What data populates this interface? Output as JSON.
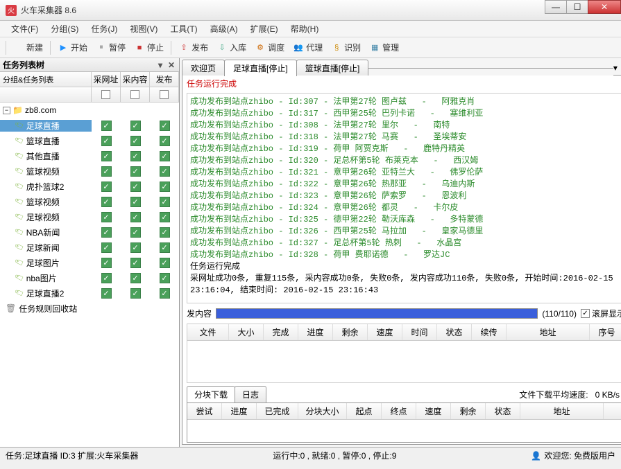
{
  "window": {
    "title": "火车采集器 8.6"
  },
  "menu": [
    "文件(F)",
    "分组(S)",
    "任务(J)",
    "视图(V)",
    "工具(T)",
    "高级(A)",
    "扩展(E)",
    "帮助(H)"
  ],
  "toolbar": [
    {
      "label": "新建",
      "icon": "",
      "color": "#555"
    },
    {
      "label": "开始",
      "icon": "▶",
      "color": "#1e90ff"
    },
    {
      "label": "暂停",
      "icon": "⏸",
      "color": "#888"
    },
    {
      "label": "停止",
      "icon": "■",
      "color": "#c33"
    },
    {
      "label": "发布",
      "icon": "⇧",
      "color": "#c33"
    },
    {
      "label": "入库",
      "icon": "⇩",
      "color": "#4a8"
    },
    {
      "label": "调度",
      "icon": "⚙",
      "color": "#c60"
    },
    {
      "label": "代理",
      "icon": "👥",
      "color": "#c33"
    },
    {
      "label": "识别",
      "icon": "§",
      "color": "#c80"
    },
    {
      "label": "管理",
      "icon": "▦",
      "color": "#48a"
    }
  ],
  "leftPane": {
    "title": "任务列表树",
    "headers": {
      "name": "分组&任务列表",
      "c1": "采网址",
      "c2": "采内容",
      "c3": "发布"
    },
    "root": "zb8.com",
    "tasks": [
      {
        "name": "足球直播",
        "selected": true
      },
      {
        "name": "篮球直播"
      },
      {
        "name": "其他直播"
      },
      {
        "name": "篮球视频"
      },
      {
        "name": "虎扑篮球2"
      },
      {
        "name": "篮球视频"
      },
      {
        "name": "足球视频"
      },
      {
        "name": "NBA新闻"
      },
      {
        "name": "足球新闻"
      },
      {
        "name": "足球图片"
      },
      {
        "name": "nba图片"
      },
      {
        "name": "足球直播2"
      }
    ],
    "trash": "任务规则回收站"
  },
  "tabs": [
    {
      "label": "欢迎页"
    },
    {
      "label": "足球直播[停止]",
      "active": true
    },
    {
      "label": "篮球直播[停止]"
    }
  ],
  "statusLine": "任务运行完成",
  "logs": [
    "成功发布到站点zhibo - Id:307 - 法甲第27轮 图卢兹   -   阿雅克肖",
    "成功发布到站点zhibo - Id:317 - 西甲第25轮 巴列卡诺   -   塞维利亚",
    "成功发布到站点zhibo - Id:308 - 法甲第27轮 里尔   -   南特",
    "成功发布到站点zhibo - Id:318 - 法甲第27轮 马赛   -   圣埃蒂安",
    "成功发布到站点zhibo - Id:319 - 荷甲 阿贾克斯   -   鹿特丹精英",
    "成功发布到站点zhibo - Id:320 - 足总杯第5轮 布莱克本   -   西汉姆",
    "成功发布到站点zhibo - Id:321 - 意甲第26轮 亚特兰大   -   佛罗伦萨",
    "成功发布到站点zhibo - Id:322 - 意甲第26轮 热那亚   -   乌迪内斯",
    "成功发布到站点zhibo - Id:323 - 意甲第26轮 萨索罗   -   恩波利",
    "成功发布到站点zhibo - Id:324 - 意甲第26轮 都灵   -   卡尔皮",
    "成功发布到站点zhibo - Id:325 - 德甲第22轮 勒沃库森   -   多特蒙德",
    "成功发布到站点zhibo - Id:326 - 西甲第25轮 马拉加   -   皇家马德里",
    "成功发布到站点zhibo - Id:327 - 足总杯第5轮 热刺   -   水晶宫",
    "成功发布到站点zhibo - Id:328 - 荷甲 费耶诺德   -   罗达JC"
  ],
  "logFooter1": "任务运行完成",
  "logFooter2": "采网址成功0条, 重复115条, 采内容成功0条, 失败0条, 发内容成功110条, 失败0条, 开始时间:2016-02-15 23:16:04, 结束时间: 2016-02-15 23:16:43",
  "progress": {
    "label": "发内容",
    "count": "(110/110)",
    "scroll": "滚屏显示"
  },
  "midCols": [
    "文件",
    "大小",
    "完成",
    "进度",
    "剩余",
    "速度",
    "时间",
    "状态",
    "续传",
    "地址",
    "序号"
  ],
  "dl": {
    "tabs": [
      "分块下载",
      "日志"
    ],
    "speedLabel": "文件下载平均速度:",
    "speedValue": "0 KB/s",
    "cols": [
      "尝试",
      "进度",
      "已完成",
      "分块大小",
      "起点",
      "终点",
      "速度",
      "剩余",
      "状态",
      "地址"
    ]
  },
  "status": {
    "left": "任务:足球直播 ID:3 扩展:火车采集器",
    "center": "运行中:0 , 就绪:0 , 暂停:0 , 停止:9",
    "right": "欢迎您: 免费版用户"
  }
}
